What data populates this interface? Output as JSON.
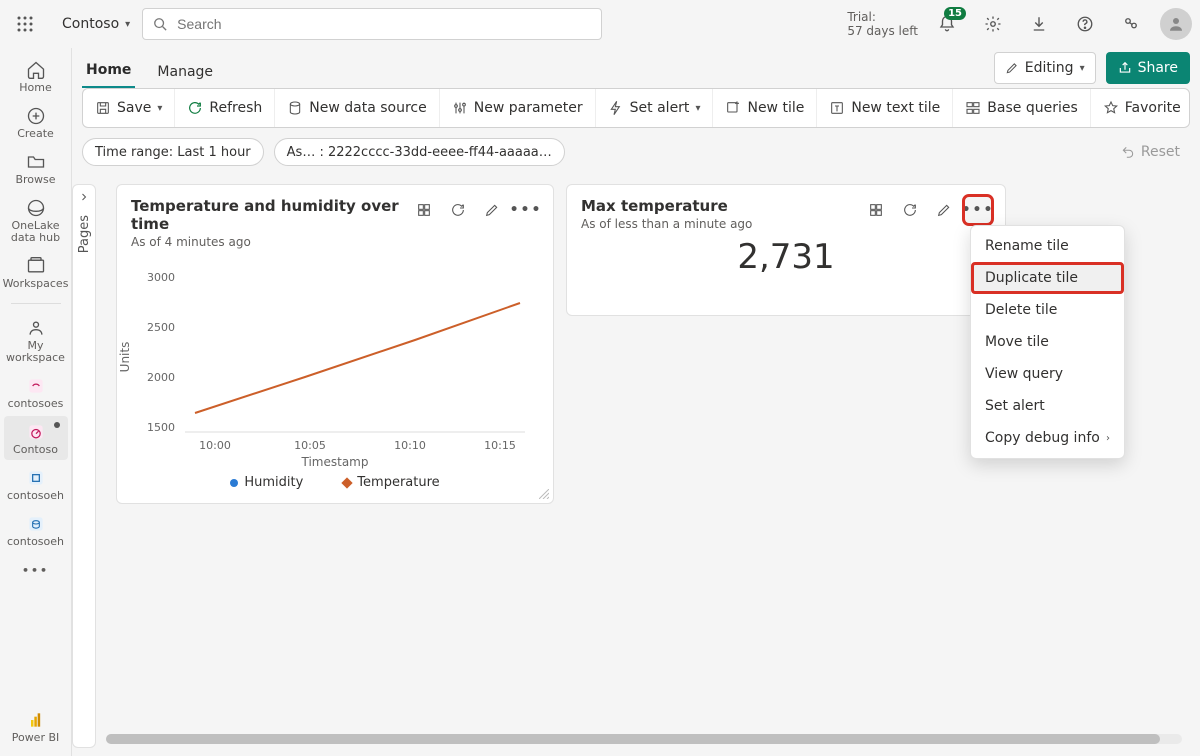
{
  "topbar": {
    "workspace_name": "Contoso",
    "search_placeholder": "Search",
    "trial_line1": "Trial:",
    "trial_line2": "57 days left",
    "notification_count": "15"
  },
  "leftnav": {
    "items": [
      {
        "label": "Home",
        "icon": "home"
      },
      {
        "label": "Create",
        "icon": "plus-circle"
      },
      {
        "label": "Browse",
        "icon": "folder"
      },
      {
        "label": "OneLake data hub",
        "icon": "onelake"
      },
      {
        "label": "Workspaces",
        "icon": "workspaces"
      },
      {
        "label": "My workspace",
        "icon": "my-workspace"
      },
      {
        "label": "contosoes",
        "icon": "eventstream"
      },
      {
        "label": "Contoso",
        "icon": "dashboard",
        "active": true,
        "dot": true
      },
      {
        "label": "contosoeh",
        "icon": "eventhouse"
      },
      {
        "label": "contosoeh",
        "icon": "kqldb"
      }
    ],
    "more": "…",
    "powerbi": "Power BI"
  },
  "tabs": {
    "items": [
      "Home",
      "Manage"
    ],
    "active_index": 0,
    "editing_label": "Editing",
    "share_label": "Share"
  },
  "toolbar": {
    "save": "Save",
    "refresh": "Refresh",
    "new_data_source": "New data source",
    "new_parameter": "New parameter",
    "set_alert": "Set alert",
    "new_tile": "New tile",
    "new_text_tile": "New text tile",
    "base_queries": "Base queries",
    "favorite": "Favorite"
  },
  "filters": {
    "time_range": "Time range: Last 1 hour",
    "param": "As… : 2222cccc-33dd-eeee-ff44-aaaaa…",
    "reset": "Reset"
  },
  "pages_label": "Pages",
  "tile1": {
    "title": "Temperature and humidity over time",
    "subtitle": "As of 4 minutes ago"
  },
  "tile2": {
    "title": "Max temperature",
    "subtitle": "As of less than a minute ago",
    "value": "2,731"
  },
  "context_menu": {
    "items": [
      "Rename tile",
      "Duplicate tile",
      "Delete tile",
      "Move tile",
      "View query",
      "Set alert",
      "Copy debug info"
    ],
    "highlighted_index": 1,
    "submenu_index": 6
  },
  "chart_data": {
    "type": "line",
    "title": "Temperature and humidity over time",
    "xlabel": "Timestamp",
    "ylabel": "Units",
    "categories": [
      "10:00",
      "10:05",
      "10:10",
      "10:15"
    ],
    "ylim": [
      1500,
      3000
    ],
    "yticks": [
      1500,
      2000,
      2500,
      3000
    ],
    "series": [
      {
        "name": "Humidity",
        "color": "#2a7bd4",
        "marker": "circle",
        "values": [
          1640,
          2000,
          2370,
          2740
        ]
      },
      {
        "name": "Temperature",
        "color": "#cc5f29",
        "marker": "diamond",
        "values": [
          1640,
          2010,
          2380,
          2750
        ]
      }
    ]
  }
}
